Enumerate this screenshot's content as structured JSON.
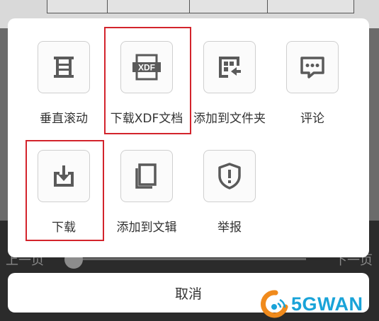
{
  "background": {
    "doc_fragments": [
      "",
      "",
      "",
      ""
    ],
    "prev_page_label": "上一页",
    "next_page_label": "下一页"
  },
  "sheet": {
    "items": [
      {
        "label": "垂直滚动",
        "icon": "vertical-scroll-icon"
      },
      {
        "label": "下载XDF文档",
        "icon": "xdf-document-icon",
        "icon_text": "XDF",
        "highlighted": true
      },
      {
        "label": "添加到文件夹",
        "icon": "add-to-folder-icon"
      },
      {
        "label": "评论",
        "icon": "comment-icon"
      },
      {
        "label": "下载",
        "icon": "download-icon",
        "highlighted": true
      },
      {
        "label": "添加到文辑",
        "icon": "add-to-collection-icon"
      },
      {
        "label": "举报",
        "icon": "report-shield-icon"
      }
    ],
    "cancel_label": "取消"
  },
  "watermark": {
    "text": "5GWAN",
    "logo": "5gwan-logo"
  },
  "colors": {
    "highlight": "#d3242c",
    "icon": "#5a5a5a",
    "watermark": "#19a3d8",
    "watermark_logo": "#f08a1c"
  }
}
